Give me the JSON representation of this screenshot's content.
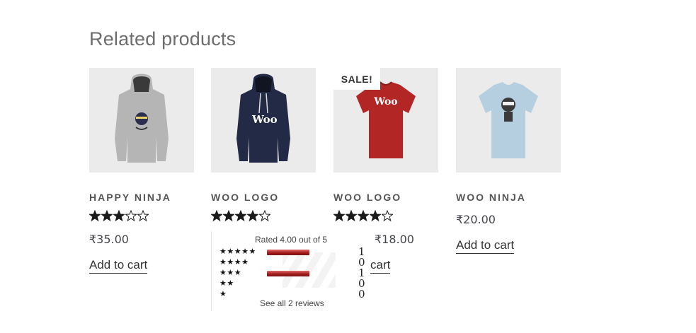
{
  "section": {
    "title": "Related products"
  },
  "products": [
    {
      "name": "HAPPY NINJA",
      "kind": "hoodie",
      "color": "#b5b5b5",
      "rating": 3,
      "price": "₹35.00",
      "cta": "Add to cart",
      "sale": false
    },
    {
      "name": "WOO LOGO",
      "kind": "hoodie",
      "color": "#232a45",
      "print": "Woo",
      "rating": 4,
      "price": "",
      "cta": "",
      "sale": false
    },
    {
      "name": "WOO LOGO",
      "kind": "tshirt",
      "color": "#b32626",
      "print": "Woo",
      "rating": 4,
      "price": "₹18.00",
      "cta": "cart",
      "sale": true,
      "sale_label": "SALE!"
    },
    {
      "name": "WOO NINJA",
      "kind": "tshirt",
      "color": "#b6cfe0",
      "rating": null,
      "price": "₹20.00",
      "cta": "Add to cart",
      "sale": false
    }
  ],
  "rating_popover": {
    "title": "Rated 4.00 out of 5",
    "rows": [
      {
        "stars": "★★★★★",
        "fraction": 0.5,
        "count": "1"
      },
      {
        "stars": "★★★★",
        "fraction": 0,
        "count": "0"
      },
      {
        "stars": "★★★",
        "fraction": 0.5,
        "count": "1"
      },
      {
        "stars": "★★",
        "fraction": 0,
        "count": "0"
      },
      {
        "stars": "★",
        "fraction": 0,
        "count": "0"
      }
    ],
    "footer": "See all 2 reviews"
  }
}
